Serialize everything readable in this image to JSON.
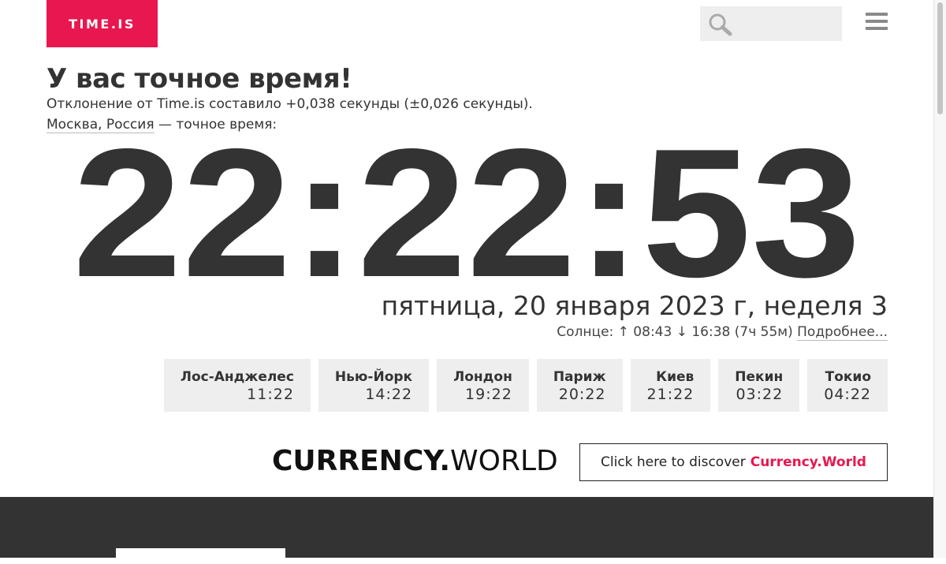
{
  "header": {
    "logo": "TIME.IS",
    "accent_color": "#e8174f",
    "search_icon": "search-icon",
    "menu_icon": "hamburger-menu-icon"
  },
  "main": {
    "heading": "У вас точное время!",
    "deviation": "Отклонение от Time.is составило +0,038 секунды (±0,026 секунды).",
    "location_link": "Москва, Россия",
    "location_suffix": " — точное время:",
    "clock": "22:22:53",
    "date": "пятница, 20 января 2023 г, неделя 3",
    "sun": {
      "prefix": "Солнце: ↑ 08:43 ↓ 16:38 (7ч 55м) ",
      "link": "Подробнее..."
    }
  },
  "cities": [
    {
      "name": "Лос-Анджелес",
      "time": "11:22"
    },
    {
      "name": "Нью-Йорк",
      "time": "14:22"
    },
    {
      "name": "Лондон",
      "time": "19:22"
    },
    {
      "name": "Париж",
      "time": "20:22"
    },
    {
      "name": "Киев",
      "time": "21:22"
    },
    {
      "name": "Пекин",
      "time": "03:22"
    },
    {
      "name": "Токио",
      "time": "04:22"
    }
  ],
  "promo": {
    "logo_bold": "CURRENCY.",
    "logo_light": "WORLD",
    "button_prefix": "Click here to discover",
    "button_highlight": "Currency.World"
  }
}
